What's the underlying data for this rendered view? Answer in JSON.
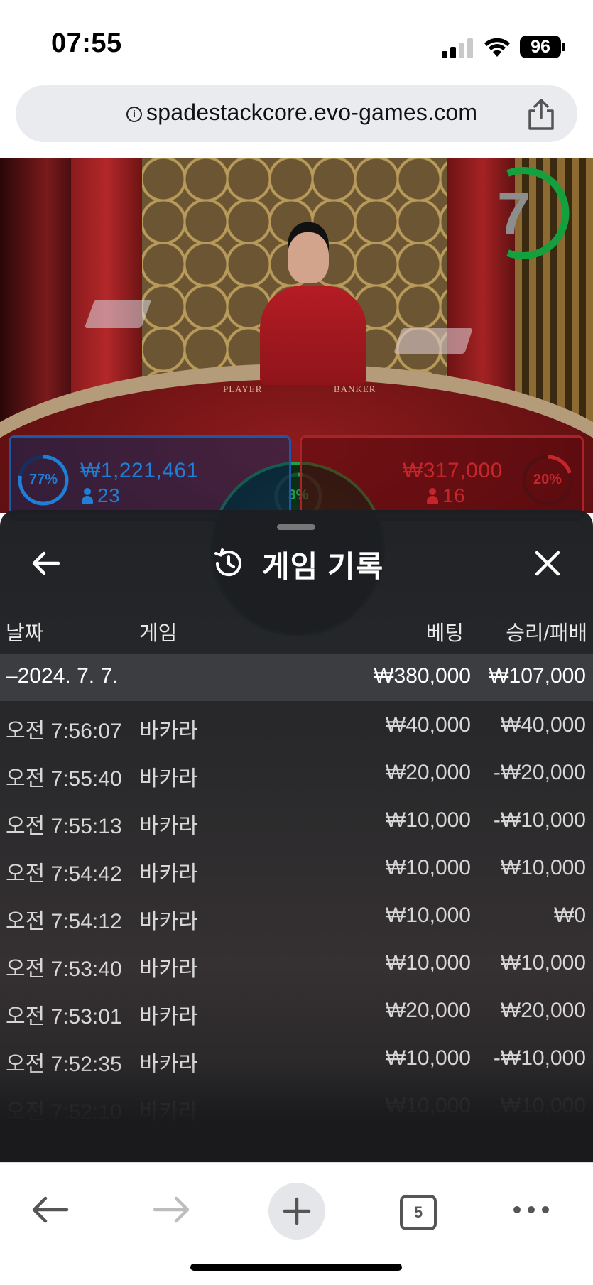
{
  "status_bar": {
    "time": "07:55",
    "battery": "96"
  },
  "browser": {
    "url": "spadestackcore.evo-games.com",
    "tab_count": "5"
  },
  "game": {
    "timer": "7",
    "table_labels": {
      "player": "PLAYER",
      "banker": "BANKER"
    },
    "player": {
      "percent": "77%",
      "amount": "₩1,221,461",
      "count": "23",
      "color": "#1f7fd6"
    },
    "banker": {
      "percent": "20%",
      "amount": "₩317,000",
      "count": "16",
      "color": "#c4262c"
    },
    "tie": {
      "percent": "3%",
      "color": "#1da144"
    }
  },
  "history": {
    "title": "게임 기록",
    "columns": {
      "date": "날짜",
      "game": "게임",
      "bet": "베팅",
      "winloss": "승리/패배"
    },
    "date_group": {
      "date": "–2024. 7. 7.",
      "bet": "₩380,000",
      "winloss": "₩107,000"
    },
    "rows": [
      {
        "time": "오전 7:56:07",
        "game": "바카라",
        "bet": "₩40,000",
        "winloss": "₩40,000"
      },
      {
        "time": "오전 7:55:40",
        "game": "바카라",
        "bet": "₩20,000",
        "winloss": "-₩20,000"
      },
      {
        "time": "오전 7:55:13",
        "game": "바카라",
        "bet": "₩10,000",
        "winloss": "-₩10,000"
      },
      {
        "time": "오전 7:54:42",
        "game": "바카라",
        "bet": "₩10,000",
        "winloss": "₩10,000"
      },
      {
        "time": "오전 7:54:12",
        "game": "바카라",
        "bet": "₩10,000",
        "winloss": "₩0"
      },
      {
        "time": "오전 7:53:40",
        "game": "바카라",
        "bet": "₩10,000",
        "winloss": "₩10,000"
      },
      {
        "time": "오전 7:53:01",
        "game": "바카라",
        "bet": "₩20,000",
        "winloss": "₩20,000"
      },
      {
        "time": "오전 7:52:35",
        "game": "바카라",
        "bet": "₩10,000",
        "winloss": "-₩10,000"
      },
      {
        "time": "오전 7:52:10",
        "game": "바카라",
        "bet": "₩10,000",
        "winloss": "₩10,000"
      }
    ]
  }
}
